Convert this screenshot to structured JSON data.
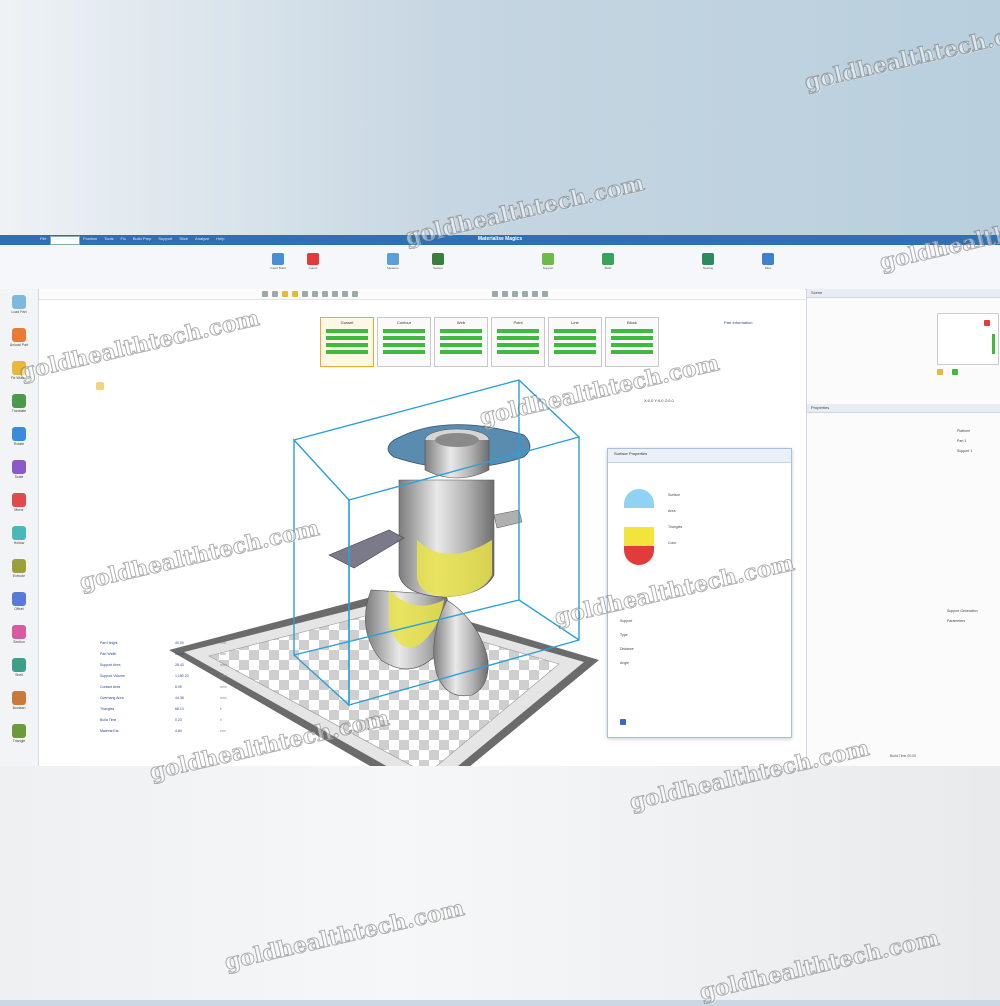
{
  "app": {
    "title": "Materialise Magics",
    "menus": [
      "File",
      "Edit",
      "View",
      "Position",
      "Tools",
      "Fix",
      "Build Prep",
      "Support",
      "Slice",
      "Analyze",
      "Help"
    ]
  },
  "ribbon": {
    "groups": [
      {
        "label": "Insert Build",
        "color": "#4a8fd6"
      },
      {
        "label": "Colors",
        "color": "#e23b3b"
      },
      {
        "label": "Measure",
        "color": "#5aa0d8"
      },
      {
        "label": "Section",
        "color": "#3a7f3a"
      },
      {
        "label": "Support",
        "color": "#6cbb4a"
      },
      {
        "label": "Build",
        "color": "#3aa35a"
      },
      {
        "label": "Nesting",
        "color": "#2e8a5e"
      },
      {
        "label": "Slice",
        "color": "#3f7fcf"
      }
    ]
  },
  "left_tools": [
    {
      "label": "Load Part",
      "color": "#7db8e0"
    },
    {
      "label": "Unload Part",
      "color": "#e87b3a"
    },
    {
      "label": "Fix Wizard",
      "color": "#e8b83a"
    },
    {
      "label": "Translate",
      "color": "#4a9a4a"
    },
    {
      "label": "Rotate",
      "color": "#3a8ae0"
    },
    {
      "label": "Scale",
      "color": "#8a5ac8"
    },
    {
      "label": "Mirror",
      "color": "#e04a4a"
    },
    {
      "label": "Hollow",
      "color": "#4ab8b8"
    },
    {
      "label": "Extrude",
      "color": "#9aa03a"
    },
    {
      "label": "Offset",
      "color": "#5a7ad8"
    },
    {
      "label": "Section",
      "color": "#d85aa0"
    },
    {
      "label": "Shell",
      "color": "#3aa08a"
    },
    {
      "label": "Boolean",
      "color": "#c87a3a"
    },
    {
      "label": "Triangle",
      "color": "#6a9a3a"
    }
  ],
  "support_cards": [
    {
      "label": "Block"
    },
    {
      "label": "Line"
    },
    {
      "label": "Point"
    },
    {
      "label": "Web"
    },
    {
      "label": "Contour"
    },
    {
      "label": "Gusset",
      "selected": true
    }
  ],
  "viewport_info": {
    "part_info": "Part Information",
    "coords": "X:0.0  Y:0.0  Z:0.0"
  },
  "float_panel": {
    "title": "Surface Properties",
    "rows": [
      "Surface",
      "Area",
      "Triangles",
      "Color",
      "Support",
      "Type",
      "Distance",
      "Angle"
    ]
  },
  "stats": [
    {
      "name": "Part Height",
      "value": "40.00",
      "unit": "mm"
    },
    {
      "name": "Part Width",
      "value": "22.16",
      "unit": "mm"
    },
    {
      "name": "Support Area",
      "value": "28.43",
      "unit": "mm²"
    },
    {
      "name": "Support Volume",
      "value": "1,180.23",
      "unit": "mm³"
    },
    {
      "name": "Contact Area",
      "value": "6.09",
      "unit": "mm²"
    },
    {
      "name": "Overhang Area",
      "value": "44.38",
      "unit": "mm²"
    },
    {
      "name": "Triangles",
      "value": "68.13",
      "unit": "k"
    },
    {
      "name": "Build Time",
      "value": "0.23",
      "unit": "h"
    },
    {
      "name": "Material Est.",
      "value": "4.84",
      "unit": "cm³"
    }
  ],
  "side_panel": {
    "top_header": "Scene",
    "mid_header": "Properties",
    "items": [
      "Platform",
      "Part 1",
      "Support 1"
    ],
    "bottom_items": [
      "Support Generation",
      "Parameters"
    ]
  },
  "status": "Build Time 00:00",
  "watermark": "goldhealthtech.com"
}
